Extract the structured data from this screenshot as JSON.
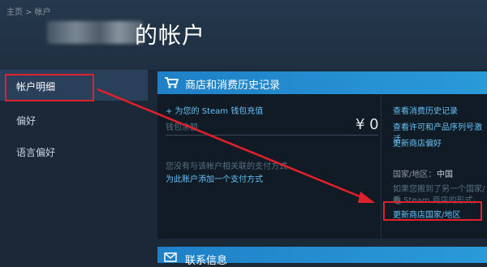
{
  "breadcrumb": {
    "home": "主页",
    "sep": " > ",
    "current": "帐户"
  },
  "page": {
    "title": "的帐户"
  },
  "sidebar": {
    "items": [
      {
        "label": "帐户明细"
      },
      {
        "label": "偏好"
      },
      {
        "label": "语言偏好"
      }
    ]
  },
  "store_panel": {
    "title": "商店和消费历史记录",
    "add_funds": "+ 为您的 Steam 钱包充值",
    "wallet_label": "钱包余额",
    "wallet_amount": "¥ 0",
    "no_payment_text": "您没有与该帐户相关联的支付方式",
    "add_payment_link": "为此账户添加一个支付方式",
    "links": [
      "查看消费历史记录",
      "查看许可和产品序列号激活",
      "更新商店偏好"
    ],
    "country_label": "国家/地区：",
    "country_value": "中国",
    "moved_text_1": "如果您搬到了另一个国家/地",
    "moved_text_2": "看 Steam 商店的形式。",
    "update_country_link": "更新商店国家/地区"
  },
  "contact_panel": {
    "title": "联系信息"
  },
  "colors": {
    "accent": "#2a9ad9",
    "link": "#66c0f4",
    "highlight": "#e0202b",
    "background": "#1b2838"
  }
}
